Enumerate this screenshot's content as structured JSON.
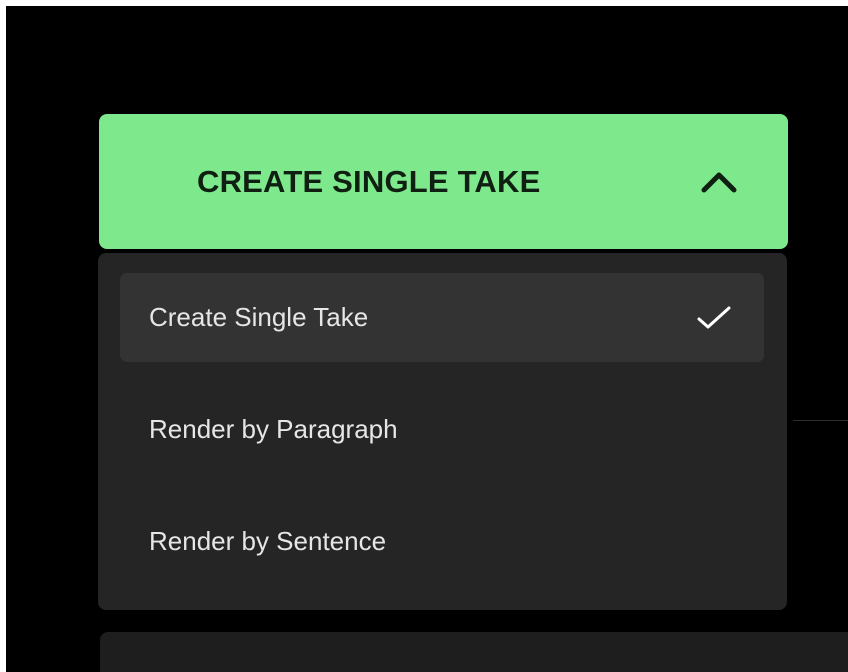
{
  "dropdown": {
    "button_label": "CREATE SINGLE TAKE",
    "expanded_icon": "chevron-up-icon",
    "accent_color": "#7ee88c",
    "items": [
      {
        "label": "Create Single Take",
        "selected": true
      },
      {
        "label": "Render by Paragraph",
        "selected": false
      },
      {
        "label": "Render by Sentence",
        "selected": false
      }
    ],
    "selected_icon": "checkmark-icon"
  }
}
